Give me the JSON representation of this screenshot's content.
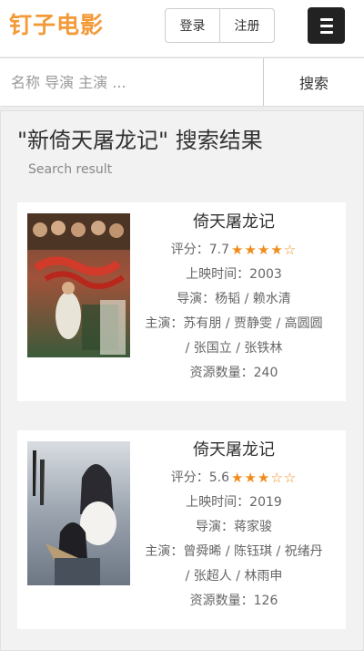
{
  "header": {
    "logo": "钉子电影",
    "login_label": "登录",
    "register_label": "注册",
    "menu_icon": "hamburger-icon"
  },
  "search": {
    "placeholder": "名称 导演 主演 ...",
    "button_label": "搜索"
  },
  "results": {
    "title": "\"新倚天屠龙记\" 搜索结果",
    "subtitle": "Search result",
    "items": [
      {
        "title": "倚天屠龙记",
        "rating_label": "评分：",
        "rating_value": "7.7",
        "stars": "★★★★☆",
        "year_line": "上映时间：2003",
        "director_line": "导演：杨韬 / 赖水清",
        "cast_line_1": "主演：苏有朋 / 贾静雯 / 高圆圆",
        "cast_line_2": "/ 张国立 / 张铁林",
        "resources_line": "资源数量：240"
      },
      {
        "title": "倚天屠龙记",
        "rating_label": "评分：",
        "rating_value": "5.6",
        "stars": "★★★☆☆",
        "year_line": "上映时间：2019",
        "director_line": "导演：蒋家骏",
        "cast_line_1": "主演：曾舜晞 / 陈钰琪 / 祝绪丹",
        "cast_line_2": "/ 张超人 / 林雨申",
        "resources_line": "资源数量：126"
      }
    ]
  },
  "colors": {
    "brand": "#f39a38",
    "star": "#f08c1c",
    "menu_bg": "#222222"
  }
}
